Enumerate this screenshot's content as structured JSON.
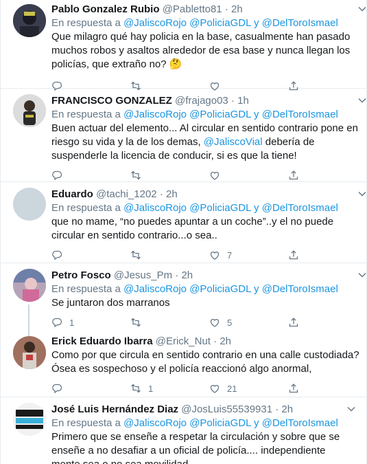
{
  "reply_prefix": "En respuesta a",
  "tweets": [
    {
      "name": "Pablo Gonzalez Rubio",
      "handle": "@Pabletto81",
      "time": "2h",
      "mentions_a": "@JaliscoRojo @PoliciaGDL",
      "conj": "y",
      "mentions_b": "@DelToroIsmael",
      "text": "Que milagro qué hay policia en la base, casualmente han pasado muchos robos y asaltos alrededor de esa base y nunca llegan los policías, que extraño no? 🤔",
      "replies": "",
      "retweets": "",
      "likes": ""
    },
    {
      "name": "FRANCISCO GONZALEZ",
      "handle": "@frajago03",
      "time": "1h",
      "mentions_a": "@JaliscoRojo @PoliciaGDL",
      "conj": "y",
      "mentions_b": "@DelToroIsmael",
      "text_a": "Buen actuar del elemento... Al circular en sentido contrario pone en riesgo su vida y la de los demas, ",
      "text_mention": "@JaliscoVial",
      "text_b": " debería de suspenderle la licencia de conducir, si es que la tiene!",
      "replies": "",
      "retweets": "",
      "likes": ""
    },
    {
      "name": "Eduardo",
      "handle": "@tachi_1202",
      "time": "2h",
      "mentions_a": "@JaliscoRojo @PoliciaGDL",
      "conj": "y",
      "mentions_b": "@DelToroIsmael",
      "text": "que no mame, “no puedes apuntar a un coche”..y el no puede circular en sentido contrario...o sea..",
      "replies": "",
      "retweets": "",
      "likes": "7"
    },
    {
      "name": "Petro Fosco",
      "handle": "@Jesus_Pm",
      "time": "2h",
      "mentions_a": "@JaliscoRojo @PoliciaGDL",
      "conj": "y",
      "mentions_b": "@DelToroIsmael",
      "text": "Se juntaron dos marranos",
      "replies": "1",
      "retweets": "",
      "likes": "5"
    },
    {
      "name": "Erick Eduardo Ibarra",
      "handle": "@Erick_Nut",
      "time": "2h",
      "text": "Como por que circula en sentido contrario en una calle custodiada? Ósea es sospechoso y el policía reaccionó algo anormal,",
      "replies": "",
      "retweets": "1",
      "likes": "21"
    },
    {
      "name": "José Luis Hernández Diaz",
      "handle": "@JosLuis55539931",
      "time": "2h",
      "mentions_a": "@JaliscoRojo @PoliciaGDL",
      "conj": "y",
      "mentions_b": "@DelToroIsmael",
      "text": "Primero que se enseñe a respetar la circulación y sobre que se enseñe a no desafiar a un oficial de policía.... independiente mente sea o no sea movilidad."
    }
  ]
}
